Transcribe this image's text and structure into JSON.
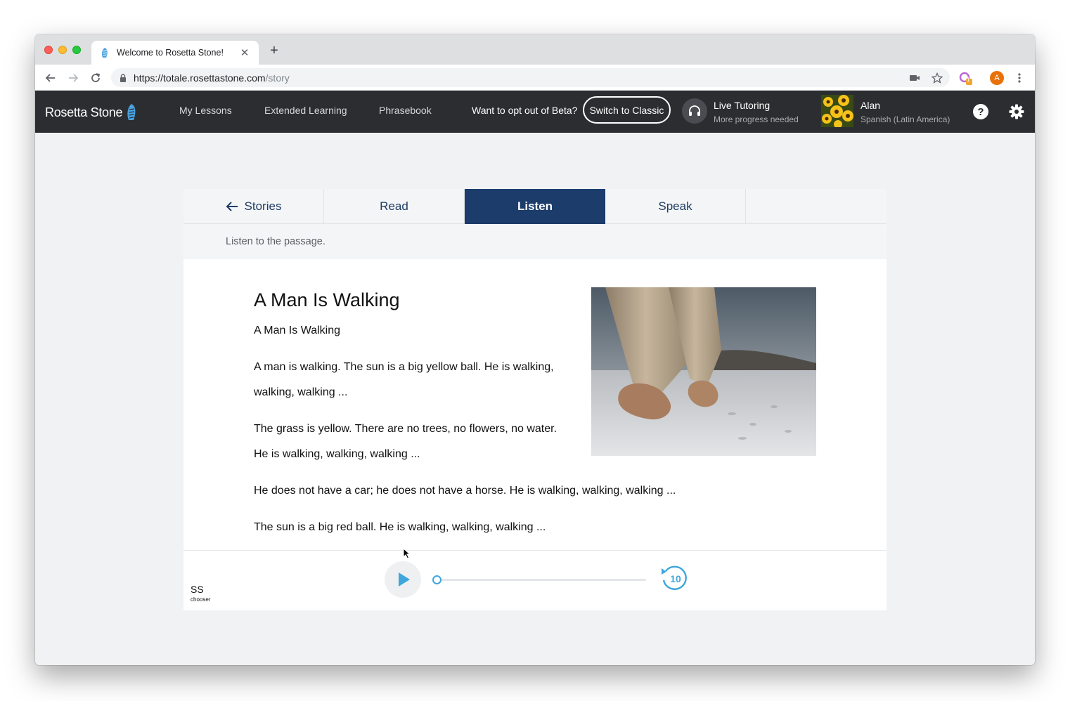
{
  "browser": {
    "tab_title": "Welcome to Rosetta Stone!",
    "url_host": "https://totale.rosettastone.com",
    "url_path": "/story",
    "profile_initial": "A",
    "extension_badge": "1"
  },
  "header": {
    "logo_text": "Rosetta Stone",
    "nav": [
      "My Lessons",
      "Extended Learning",
      "Phrasebook"
    ],
    "beta_question": "Want to opt out of Beta?",
    "switch_classic": "Switch to Classic",
    "tutoring_title": "Live Tutoring",
    "tutoring_status": "More progress needed",
    "user_name": "Alan",
    "user_language": "Spanish (Latin America)",
    "help_label": "?"
  },
  "tabs": {
    "stories": "Stories",
    "read": "Read",
    "listen": "Listen",
    "speak": "Speak",
    "active": "Listen"
  },
  "instruction": "Listen to the passage.",
  "story": {
    "title": "A Man Is Walking",
    "subtitle": "A Man Is Walking",
    "paragraphs": [
      [
        "A man is walking. The sun is a big yellow ball. He is walking,",
        "walking, walking ..."
      ],
      [
        "The grass is yellow. There are no trees, no flowers, no water.",
        "He is walking, walking, walking ..."
      ],
      [
        "He does not have a car; he does not have a horse. He is walking, walking, walking ..."
      ],
      [
        "The sun is a big red ball. He is walking, walking, walking ..."
      ]
    ],
    "image_icon": "barefoot-walking-photo"
  },
  "player": {
    "ss_label": "SS",
    "ss_sub": "chooser",
    "progress": 0.0,
    "replay_seconds": "10"
  },
  "colors": {
    "header_bg": "#2b2d31",
    "active_tab": "#1c3d6b",
    "accent": "#3fa7dc"
  }
}
